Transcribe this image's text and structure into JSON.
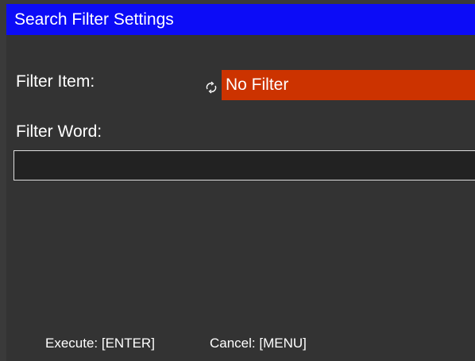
{
  "window": {
    "title": "Search Filter Settings"
  },
  "filter_item": {
    "label": "Filter Item:",
    "value": "No Filter",
    "icon": "cycle-icon"
  },
  "filter_word": {
    "label": "Filter Word:",
    "value": ""
  },
  "footer": {
    "execute": "Execute: [ENTER]",
    "cancel": "Cancel: [MENU]"
  },
  "colors": {
    "title_bar": "#0c0cf7",
    "background": "#333333",
    "selection": "#cc3300",
    "input_background": "#222222"
  }
}
